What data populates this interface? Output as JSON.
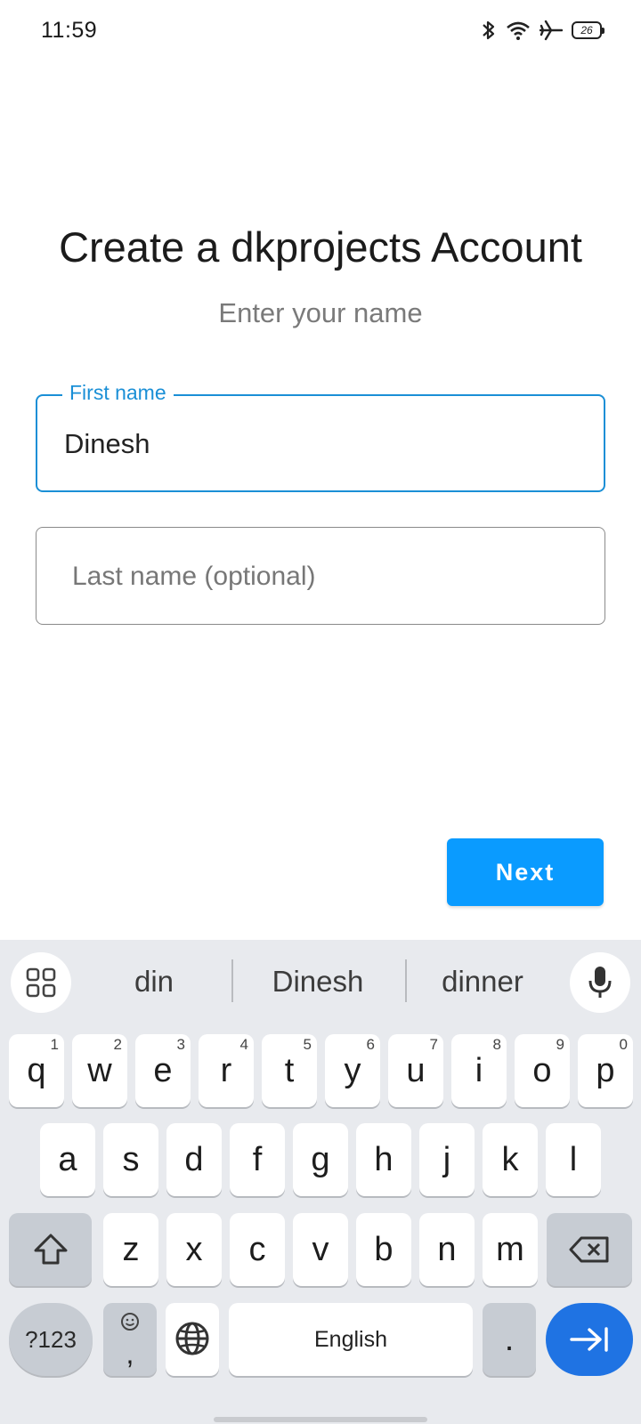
{
  "status_bar": {
    "time": "11:59",
    "battery": "26"
  },
  "header": {
    "title": "Create a dkprojects Account",
    "subtitle": "Enter your name"
  },
  "form": {
    "first_name_label": "First name",
    "first_name_value": "Dinesh",
    "last_name_placeholder": "Last name (optional)"
  },
  "next_button_label": "Next",
  "keyboard": {
    "suggestions": [
      "din",
      "Dinesh",
      "dinner"
    ],
    "row1": [
      {
        "k": "q",
        "n": "1"
      },
      {
        "k": "w",
        "n": "2"
      },
      {
        "k": "e",
        "n": "3"
      },
      {
        "k": "r",
        "n": "4"
      },
      {
        "k": "t",
        "n": "5"
      },
      {
        "k": "y",
        "n": "6"
      },
      {
        "k": "u",
        "n": "7"
      },
      {
        "k": "i",
        "n": "8"
      },
      {
        "k": "o",
        "n": "9"
      },
      {
        "k": "p",
        "n": "0"
      }
    ],
    "row2": [
      "a",
      "s",
      "d",
      "f",
      "g",
      "h",
      "j",
      "k",
      "l"
    ],
    "row3": [
      "z",
      "x",
      "c",
      "v",
      "b",
      "n",
      "m"
    ],
    "symbols_label": "?123",
    "emoji_comma": ",",
    "space_label": "English",
    "period_label": "."
  },
  "icons": {
    "bluetooth": "bluetooth-icon",
    "wifi": "wifi-icon",
    "airplane": "airplane-icon",
    "apps": "apps-grid-icon",
    "mic": "mic-icon",
    "shift": "shift-icon",
    "backspace": "backspace-icon",
    "globe": "globe-icon",
    "enter": "next-field-icon",
    "emoji": "emoji-icon"
  },
  "colors": {
    "accent": "#1a8fd6",
    "button": "#0a9bff",
    "enter_key": "#1f73e3",
    "keyboard_bg": "#e8eaee"
  }
}
